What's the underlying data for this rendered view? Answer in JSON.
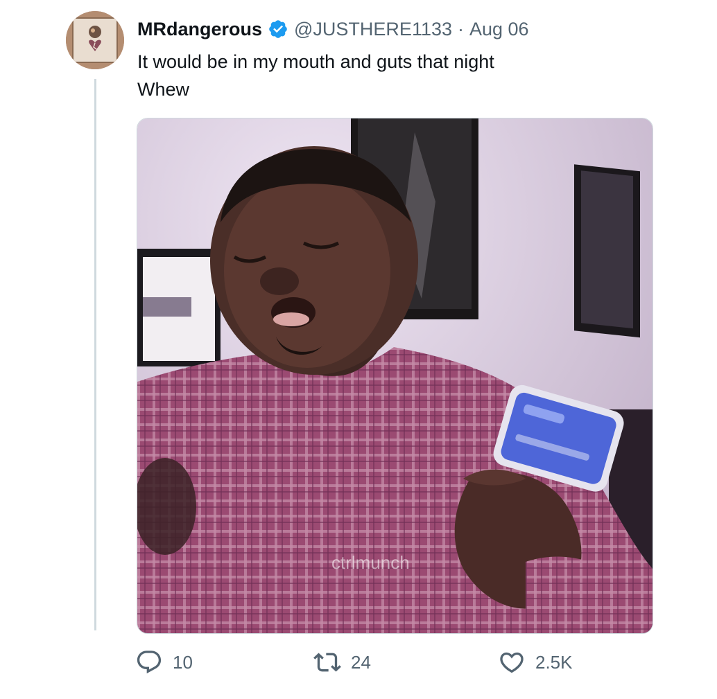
{
  "tweet": {
    "author": {
      "display_name": "MRdangerous",
      "handle": "@JUSTHERE1133",
      "verified": true
    },
    "separator": "·",
    "date": "Aug 06",
    "text_lines": [
      "It would be in my mouth and guts that night",
      "Whew"
    ],
    "media": {
      "type": "gif",
      "watermark": "ctrlmunch"
    },
    "actions": {
      "replies": "10",
      "retweets": "24",
      "likes": "2.5K"
    }
  },
  "colors": {
    "text": "#0f1419",
    "muted": "#536471",
    "verified": "#1d9bf0",
    "border": "#cfd9de"
  },
  "icons": {
    "reply": "reply-icon",
    "retweet": "retweet-icon",
    "like": "heart-icon",
    "verified": "verified-badge-icon"
  }
}
